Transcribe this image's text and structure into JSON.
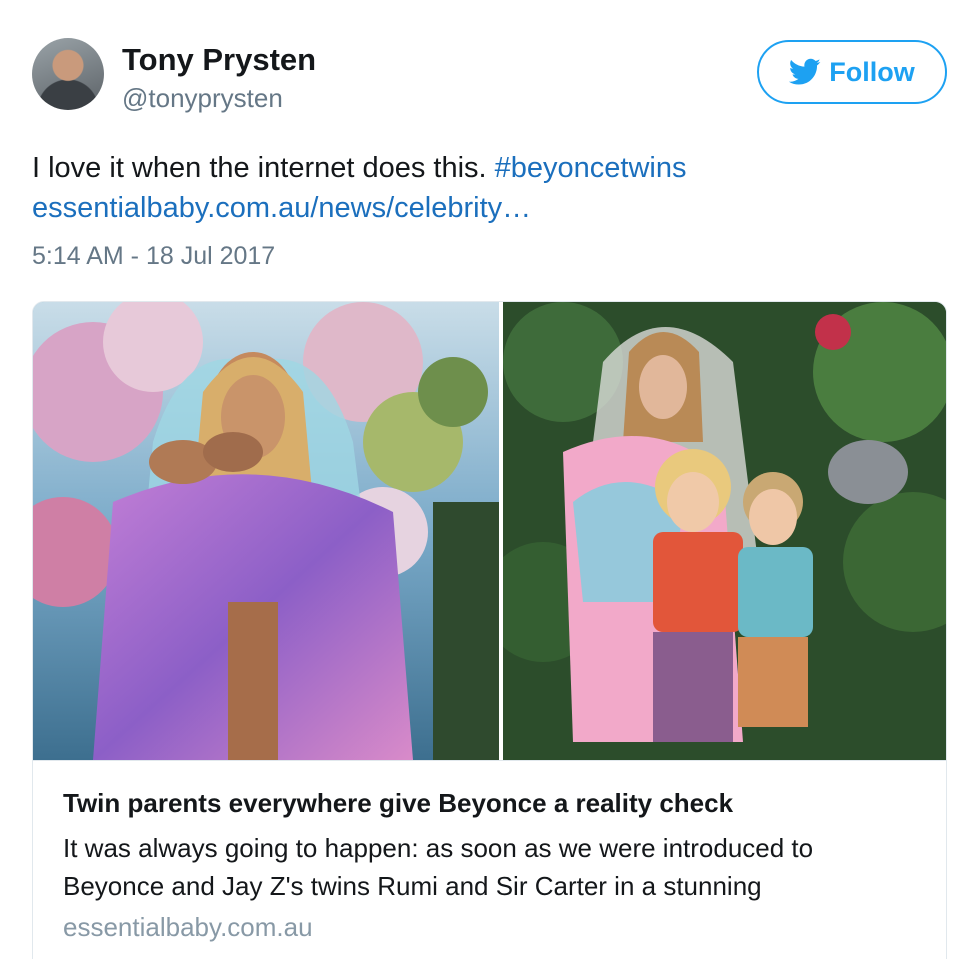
{
  "user": {
    "display_name": "Tony Prysten",
    "handle": "@tonyprysten"
  },
  "follow_button": {
    "label": "Follow",
    "icon": "twitter-bird-icon"
  },
  "tweet": {
    "text_prefix": "I love it when the internet does this. ",
    "hashtag": "#beyoncetwins",
    "link": "essentialbaby.com.au/news/celebrity…",
    "timestamp": "5:14 AM - 18 Jul 2017"
  },
  "card": {
    "title": "Twin parents everywhere give Beyonce a reality check",
    "description": "It was always going to happen: as soon as we were introduced to Beyonce and Jay Z's twins Rumi and Sir Carter in a stunning",
    "domain": "essentialbaby.com.au"
  },
  "colors": {
    "link": "#1b6fbd",
    "follow_accent": "#1da1f2",
    "secondary_text": "#657786"
  }
}
